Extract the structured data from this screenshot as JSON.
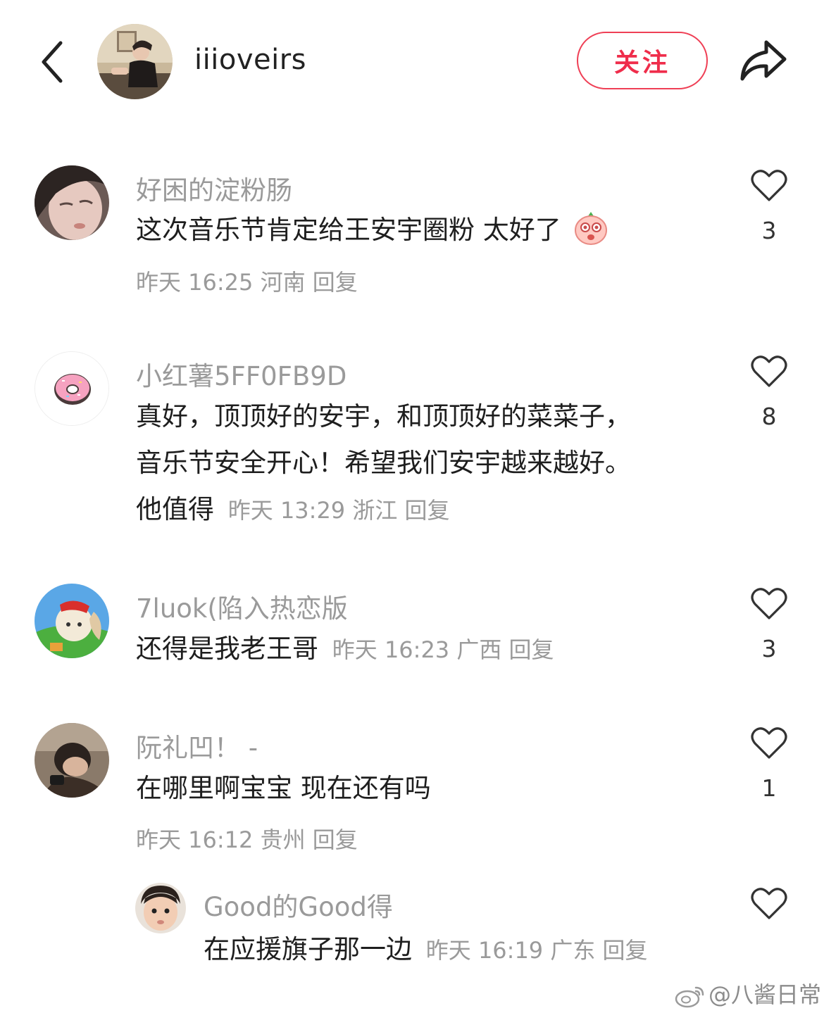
{
  "header": {
    "profile_name": "iiioveirs",
    "follow_label": "关注"
  },
  "comments": [
    {
      "username": "好困的淀粉肠",
      "text": "这次音乐节肯定给王安宇圈粉 太好了",
      "time": "昨天 16:25",
      "location": "河南",
      "reply_label": "回复",
      "likes": "3"
    },
    {
      "username": "小红薯5FF0FB9D",
      "text_lines": [
        "真好，顶顶好的安宇，和顶顶好的菜菜子，",
        "音乐节安全开心！希望我们安宇越来越好。",
        "他值得"
      ],
      "time": "昨天 13:29",
      "location": "浙江",
      "reply_label": "回复",
      "likes": "8"
    },
    {
      "username": "7luok(陷入热恋版",
      "text": "还得是我老王哥",
      "time": "昨天 16:23",
      "location": "广西",
      "reply_label": "回复",
      "likes": "3"
    },
    {
      "username": "阮礼凹！ -",
      "text": "在哪里啊宝宝 现在还有吗",
      "time": "昨天 16:12",
      "location": "贵州",
      "reply_label": "回复",
      "likes": "1"
    },
    {
      "username": "Good的Good得",
      "text": "在应援旗子那一边",
      "time": "昨天 16:19",
      "location": "广东",
      "reply_label": "回复",
      "likes": ""
    }
  ],
  "watermark": "@八酱日常",
  "colors": {
    "accent": "#ef2d4b",
    "meta_gray": "#9a9a9a",
    "text": "#1e1e1e"
  },
  "icons": [
    "back-arrow-icon",
    "share-icon",
    "heart-icon",
    "blush-emoji-icon",
    "weibo-logo-icon"
  ]
}
